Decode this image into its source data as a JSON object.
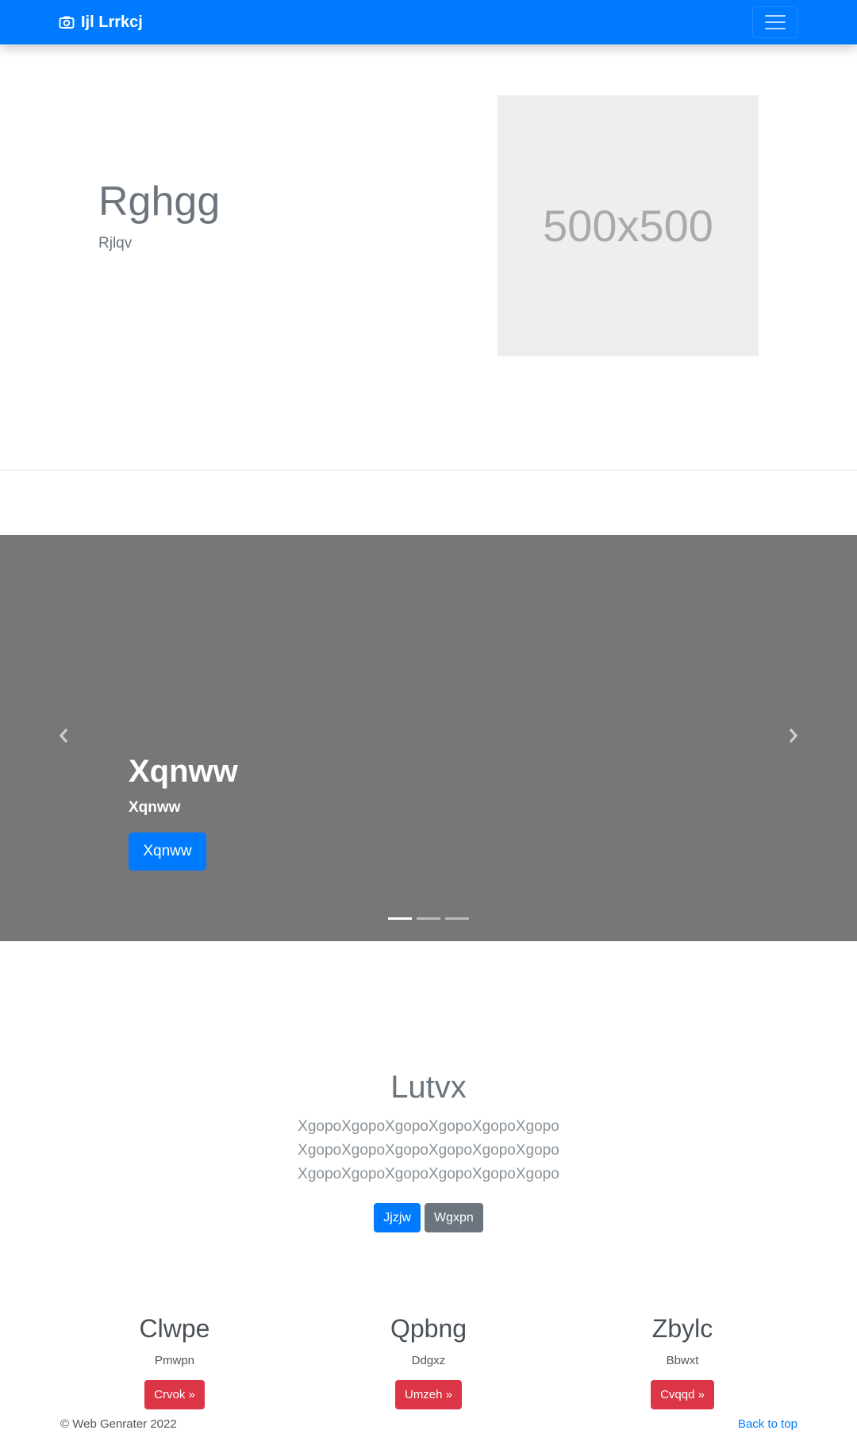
{
  "navbar": {
    "brand": "Ijl Lrrkcj",
    "brand_icon": "camera-icon",
    "toggle_icon": "hamburger-icon"
  },
  "hero": {
    "title": "Rghgg",
    "subtitle": "Rjlqv",
    "placeholder_text": "500x500"
  },
  "carousel": {
    "title": "Xqnww",
    "subtitle": "Xqnww",
    "button": "Xqnww",
    "prev_icon": "chevron-left-icon",
    "next_icon": "chevron-right-icon",
    "slide_count": 3,
    "active_index": 0
  },
  "jumbotron": {
    "title": "Lutvx",
    "lines": [
      "XgopoXgopoXgopoXgopoXgopoXgopo",
      "XgopoXgopoXgopoXgopoXgopoXgopo",
      "XgopoXgopoXgopoXgopoXgopoXgopo"
    ],
    "primary_button": "Jjzjw",
    "secondary_button": "Wgxpn"
  },
  "features": [
    {
      "title": "Clwpe",
      "text": "Pmwpn",
      "button": "Crvok »"
    },
    {
      "title": "Qpbng",
      "text": "Ddgxz",
      "button": "Umzeh »"
    },
    {
      "title": "Zbylc",
      "text": "Bbwxt",
      "button": "Cvqqd »"
    }
  ],
  "footer": {
    "copyright": "© Web Genrater 2022",
    "back_to_top": "Back to top"
  },
  "colors": {
    "primary": "#007bff",
    "secondary": "#6c757d",
    "danger": "#dc3545",
    "carousel_bg": "#777777",
    "placeholder_bg": "#eeeeee"
  }
}
